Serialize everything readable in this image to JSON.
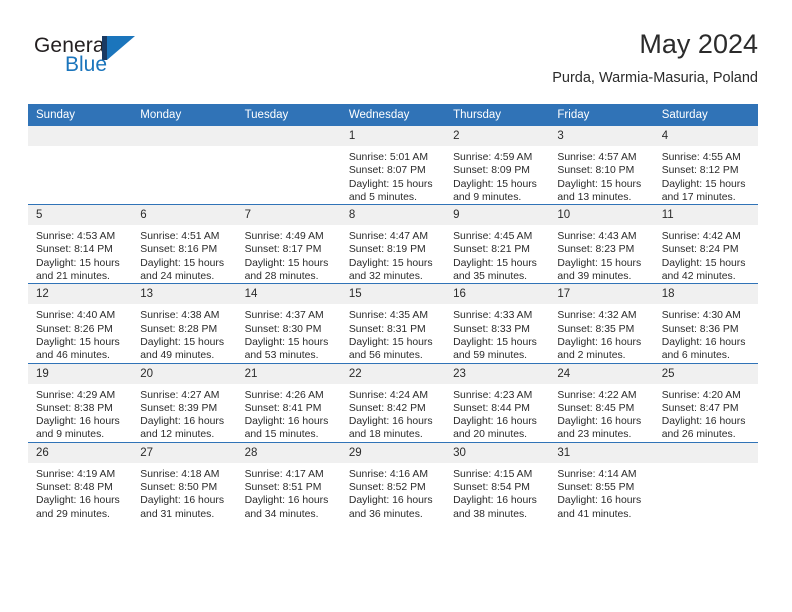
{
  "brand": {
    "name_part1": "General",
    "name_part2": "Blue"
  },
  "header": {
    "title": "May 2024",
    "subtitle": "Purda, Warmia-Masuria, Poland"
  },
  "colors": {
    "header_blue": "#3073b7",
    "daynum_gray": "#f0f0f0",
    "brand_blue": "#1b75bc",
    "brand_dark": "#1a3a63",
    "text": "#2b2b2b"
  },
  "weekdays": [
    "Sunday",
    "Monday",
    "Tuesday",
    "Wednesday",
    "Thursday",
    "Friday",
    "Saturday"
  ],
  "labels": {
    "sunrise": "Sunrise:",
    "sunset": "Sunset:",
    "daylight": "Daylight:"
  },
  "weeks": [
    [
      {
        "day": "",
        "sunrise": "",
        "sunset": "",
        "daylight_a": "",
        "daylight_b": ""
      },
      {
        "day": "",
        "sunrise": "",
        "sunset": "",
        "daylight_a": "",
        "daylight_b": ""
      },
      {
        "day": "",
        "sunrise": "",
        "sunset": "",
        "daylight_a": "",
        "daylight_b": ""
      },
      {
        "day": "1",
        "sunrise": "Sunrise: 5:01 AM",
        "sunset": "Sunset: 8:07 PM",
        "daylight_a": "Daylight: 15 hours",
        "daylight_b": "and 5 minutes."
      },
      {
        "day": "2",
        "sunrise": "Sunrise: 4:59 AM",
        "sunset": "Sunset: 8:09 PM",
        "daylight_a": "Daylight: 15 hours",
        "daylight_b": "and 9 minutes."
      },
      {
        "day": "3",
        "sunrise": "Sunrise: 4:57 AM",
        "sunset": "Sunset: 8:10 PM",
        "daylight_a": "Daylight: 15 hours",
        "daylight_b": "and 13 minutes."
      },
      {
        "day": "4",
        "sunrise": "Sunrise: 4:55 AM",
        "sunset": "Sunset: 8:12 PM",
        "daylight_a": "Daylight: 15 hours",
        "daylight_b": "and 17 minutes."
      }
    ],
    [
      {
        "day": "5",
        "sunrise": "Sunrise: 4:53 AM",
        "sunset": "Sunset: 8:14 PM",
        "daylight_a": "Daylight: 15 hours",
        "daylight_b": "and 21 minutes."
      },
      {
        "day": "6",
        "sunrise": "Sunrise: 4:51 AM",
        "sunset": "Sunset: 8:16 PM",
        "daylight_a": "Daylight: 15 hours",
        "daylight_b": "and 24 minutes."
      },
      {
        "day": "7",
        "sunrise": "Sunrise: 4:49 AM",
        "sunset": "Sunset: 8:17 PM",
        "daylight_a": "Daylight: 15 hours",
        "daylight_b": "and 28 minutes."
      },
      {
        "day": "8",
        "sunrise": "Sunrise: 4:47 AM",
        "sunset": "Sunset: 8:19 PM",
        "daylight_a": "Daylight: 15 hours",
        "daylight_b": "and 32 minutes."
      },
      {
        "day": "9",
        "sunrise": "Sunrise: 4:45 AM",
        "sunset": "Sunset: 8:21 PM",
        "daylight_a": "Daylight: 15 hours",
        "daylight_b": "and 35 minutes."
      },
      {
        "day": "10",
        "sunrise": "Sunrise: 4:43 AM",
        "sunset": "Sunset: 8:23 PM",
        "daylight_a": "Daylight: 15 hours",
        "daylight_b": "and 39 minutes."
      },
      {
        "day": "11",
        "sunrise": "Sunrise: 4:42 AM",
        "sunset": "Sunset: 8:24 PM",
        "daylight_a": "Daylight: 15 hours",
        "daylight_b": "and 42 minutes."
      }
    ],
    [
      {
        "day": "12",
        "sunrise": "Sunrise: 4:40 AM",
        "sunset": "Sunset: 8:26 PM",
        "daylight_a": "Daylight: 15 hours",
        "daylight_b": "and 46 minutes."
      },
      {
        "day": "13",
        "sunrise": "Sunrise: 4:38 AM",
        "sunset": "Sunset: 8:28 PM",
        "daylight_a": "Daylight: 15 hours",
        "daylight_b": "and 49 minutes."
      },
      {
        "day": "14",
        "sunrise": "Sunrise: 4:37 AM",
        "sunset": "Sunset: 8:30 PM",
        "daylight_a": "Daylight: 15 hours",
        "daylight_b": "and 53 minutes."
      },
      {
        "day": "15",
        "sunrise": "Sunrise: 4:35 AM",
        "sunset": "Sunset: 8:31 PM",
        "daylight_a": "Daylight: 15 hours",
        "daylight_b": "and 56 minutes."
      },
      {
        "day": "16",
        "sunrise": "Sunrise: 4:33 AM",
        "sunset": "Sunset: 8:33 PM",
        "daylight_a": "Daylight: 15 hours",
        "daylight_b": "and 59 minutes."
      },
      {
        "day": "17",
        "sunrise": "Sunrise: 4:32 AM",
        "sunset": "Sunset: 8:35 PM",
        "daylight_a": "Daylight: 16 hours",
        "daylight_b": "and 2 minutes."
      },
      {
        "day": "18",
        "sunrise": "Sunrise: 4:30 AM",
        "sunset": "Sunset: 8:36 PM",
        "daylight_a": "Daylight: 16 hours",
        "daylight_b": "and 6 minutes."
      }
    ],
    [
      {
        "day": "19",
        "sunrise": "Sunrise: 4:29 AM",
        "sunset": "Sunset: 8:38 PM",
        "daylight_a": "Daylight: 16 hours",
        "daylight_b": "and 9 minutes."
      },
      {
        "day": "20",
        "sunrise": "Sunrise: 4:27 AM",
        "sunset": "Sunset: 8:39 PM",
        "daylight_a": "Daylight: 16 hours",
        "daylight_b": "and 12 minutes."
      },
      {
        "day": "21",
        "sunrise": "Sunrise: 4:26 AM",
        "sunset": "Sunset: 8:41 PM",
        "daylight_a": "Daylight: 16 hours",
        "daylight_b": "and 15 minutes."
      },
      {
        "day": "22",
        "sunrise": "Sunrise: 4:24 AM",
        "sunset": "Sunset: 8:42 PM",
        "daylight_a": "Daylight: 16 hours",
        "daylight_b": "and 18 minutes."
      },
      {
        "day": "23",
        "sunrise": "Sunrise: 4:23 AM",
        "sunset": "Sunset: 8:44 PM",
        "daylight_a": "Daylight: 16 hours",
        "daylight_b": "and 20 minutes."
      },
      {
        "day": "24",
        "sunrise": "Sunrise: 4:22 AM",
        "sunset": "Sunset: 8:45 PM",
        "daylight_a": "Daylight: 16 hours",
        "daylight_b": "and 23 minutes."
      },
      {
        "day": "25",
        "sunrise": "Sunrise: 4:20 AM",
        "sunset": "Sunset: 8:47 PM",
        "daylight_a": "Daylight: 16 hours",
        "daylight_b": "and 26 minutes."
      }
    ],
    [
      {
        "day": "26",
        "sunrise": "Sunrise: 4:19 AM",
        "sunset": "Sunset: 8:48 PM",
        "daylight_a": "Daylight: 16 hours",
        "daylight_b": "and 29 minutes."
      },
      {
        "day": "27",
        "sunrise": "Sunrise: 4:18 AM",
        "sunset": "Sunset: 8:50 PM",
        "daylight_a": "Daylight: 16 hours",
        "daylight_b": "and 31 minutes."
      },
      {
        "day": "28",
        "sunrise": "Sunrise: 4:17 AM",
        "sunset": "Sunset: 8:51 PM",
        "daylight_a": "Daylight: 16 hours",
        "daylight_b": "and 34 minutes."
      },
      {
        "day": "29",
        "sunrise": "Sunrise: 4:16 AM",
        "sunset": "Sunset: 8:52 PM",
        "daylight_a": "Daylight: 16 hours",
        "daylight_b": "and 36 minutes."
      },
      {
        "day": "30",
        "sunrise": "Sunrise: 4:15 AM",
        "sunset": "Sunset: 8:54 PM",
        "daylight_a": "Daylight: 16 hours",
        "daylight_b": "and 38 minutes."
      },
      {
        "day": "31",
        "sunrise": "Sunrise: 4:14 AM",
        "sunset": "Sunset: 8:55 PM",
        "daylight_a": "Daylight: 16 hours",
        "daylight_b": "and 41 minutes."
      },
      {
        "day": "",
        "sunrise": "",
        "sunset": "",
        "daylight_a": "",
        "daylight_b": ""
      }
    ]
  ]
}
